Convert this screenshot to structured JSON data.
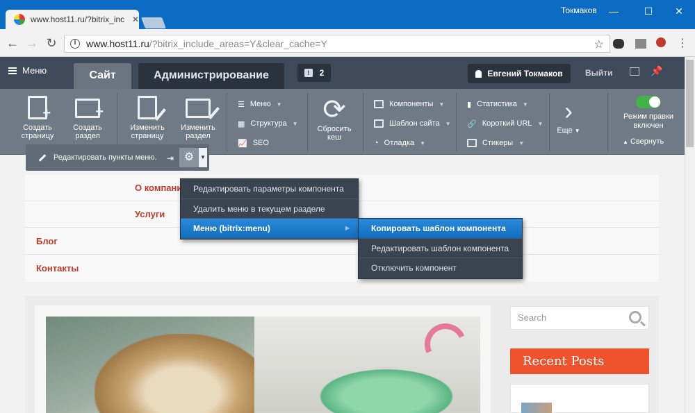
{
  "browser": {
    "tab_title": "www.host11.ru/?bitrix_inc",
    "user": "Токмаков",
    "url_host": "www.host11.ru",
    "url_path": "/?bitrix_include_areas=Y&clear_cache=Y"
  },
  "panel": {
    "menu_label": "Меню",
    "tab_site": "Сайт",
    "tab_admin": "Администрирование",
    "notifications": "2",
    "user_name": "Евгений Токмаков",
    "logout": "Выйти",
    "buttons": {
      "create_page": "Создать страницу",
      "create_section": "Создать раздел",
      "edit_page": "Изменить страницу",
      "edit_section": "Изменить раздел",
      "menu": "Меню",
      "structure": "Структура",
      "seo": "SEO",
      "reset_cache": "Сбросить кеш",
      "components": "Компоненты",
      "site_template": "Шаблон сайта",
      "debug": "Отладка",
      "statistics": "Статистика",
      "short_url": "Короткий URL",
      "stickers": "Стикеры",
      "more": "Еще",
      "edit_mode": "Режим правки включен",
      "collapse": "Свернуть"
    }
  },
  "component_toolbar": {
    "edit_menu_items": "Редактировать пункты меню."
  },
  "context_menu": {
    "items": [
      "Редактировать параметры компонента",
      "Удалить меню в текущем разделе",
      "Меню (bitrix:menu)"
    ]
  },
  "submenu": {
    "items": [
      "Копировать шаблон компонента",
      "Редактировать шаблон компонента",
      "Отключить компонент"
    ]
  },
  "site_nav": {
    "items": [
      "О компании",
      "Услуги",
      "Блог",
      "Контакты"
    ]
  },
  "sidebar": {
    "search_placeholder": "Search",
    "recent_posts": "Recent Posts"
  },
  "colors": {
    "browser_blue": "#0c6bc2",
    "panel_dark": "#3e4a59",
    "menu_active": "#1a7bcf",
    "link_red": "#c0392b",
    "recent_orange": "#f0532b"
  }
}
